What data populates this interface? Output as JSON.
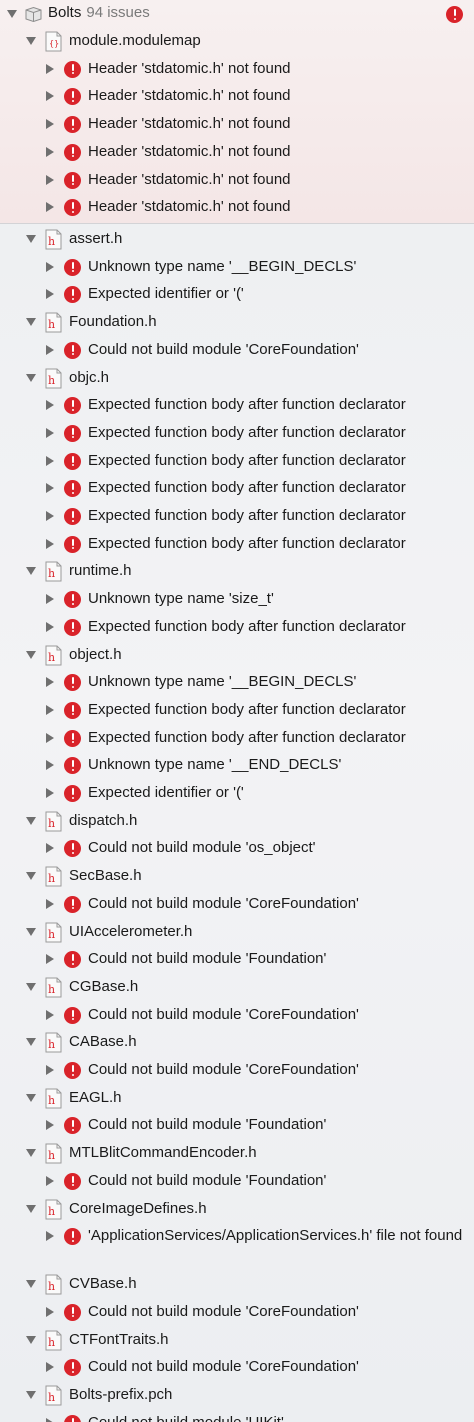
{
  "root": {
    "name": "Bolts",
    "count": "94 issues"
  },
  "colors": {
    "error": "#d9232a",
    "file_icon_accent": "#d9232a",
    "disclosure": "#6f6f6f"
  },
  "groups": [
    {
      "file": "module.modulemap",
      "issues": [
        "Header 'stdatomic.h' not found",
        "Header 'stdatomic.h' not found",
        "Header 'stdatomic.h' not found",
        "Header 'stdatomic.h' not found",
        "Header 'stdatomic.h' not found",
        "Header 'stdatomic.h' not found"
      ]
    },
    {
      "file": "assert.h",
      "issues": [
        "Unknown type name '__BEGIN_DECLS'",
        "Expected identifier or '('"
      ]
    },
    {
      "file": "Foundation.h",
      "issues": [
        "Could not build module 'CoreFoundation'"
      ]
    },
    {
      "file": "objc.h",
      "issues": [
        "Expected function body after function declarator",
        "Expected function body after function declarator",
        "Expected function body after function declarator",
        "Expected function body after function declarator",
        "Expected function body after function declarator",
        "Expected function body after function declarator"
      ]
    },
    {
      "file": "runtime.h",
      "issues": [
        "Unknown type name 'size_t'",
        "Expected function body after function declarator"
      ]
    },
    {
      "file": "object.h",
      "issues": [
        "Unknown type name '__BEGIN_DECLS'",
        "Expected function body after function declarator",
        "Expected function body after function declarator",
        "Unknown type name '__END_DECLS'",
        "Expected identifier or '('"
      ]
    },
    {
      "file": "dispatch.h",
      "issues": [
        "Could not build module 'os_object'"
      ]
    },
    {
      "file": "SecBase.h",
      "issues": [
        "Could not build module 'CoreFoundation'"
      ]
    },
    {
      "file": "UIAccelerometer.h",
      "issues": [
        "Could not build module 'Foundation'"
      ]
    },
    {
      "file": "CGBase.h",
      "issues": [
        "Could not build module 'CoreFoundation'"
      ]
    },
    {
      "file": "CABase.h",
      "issues": [
        "Could not build module 'CoreFoundation'"
      ]
    },
    {
      "file": "EAGL.h",
      "issues": [
        "Could not build module 'Foundation'"
      ]
    },
    {
      "file": "MTLBlitCommandEncoder.h",
      "issues": [
        "Could not build module 'Foundation'"
      ]
    },
    {
      "file": "CoreImageDefines.h",
      "issues": [
        "'ApplicationServices/ApplicationServices.h' file not found"
      ]
    },
    {
      "file": "CVBase.h",
      "issues": [
        "Could not build module 'CoreFoundation'"
      ]
    },
    {
      "file": "CTFontTraits.h",
      "issues": [
        "Could not build module 'CoreFoundation'"
      ]
    },
    {
      "file": "Bolts-prefix.pch",
      "issues": [
        "Could not build module 'UIKit'"
      ]
    }
  ]
}
